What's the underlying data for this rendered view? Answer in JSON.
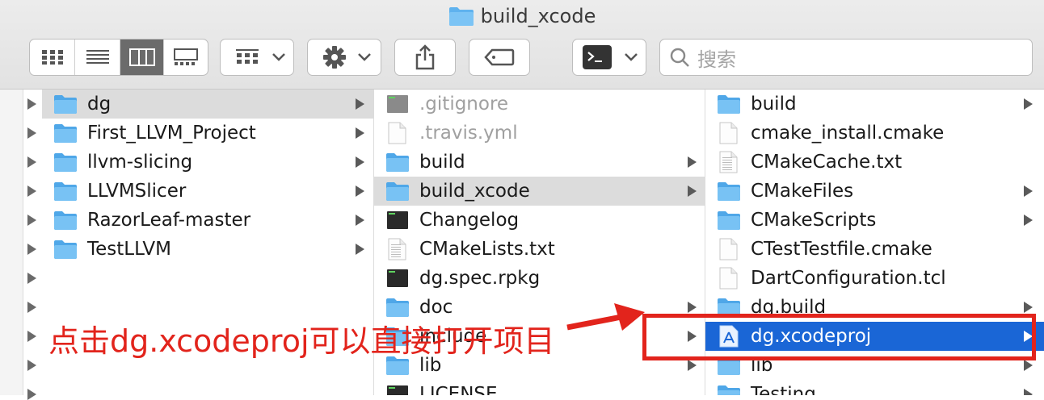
{
  "window": {
    "title": "build_xcode"
  },
  "toolbar": {
    "view_modes": [
      "icon-view",
      "list-view",
      "column-view",
      "gallery-view"
    ],
    "active_view": "column-view",
    "search_placeholder": "搜索"
  },
  "columns": [
    {
      "items": [
        {
          "name": "dg",
          "type": "folder",
          "selected": true,
          "has_children": true
        },
        {
          "name": "First_LLVM_Project",
          "type": "folder",
          "has_children": true
        },
        {
          "name": "llvm-slicing",
          "type": "folder",
          "has_children": true
        },
        {
          "name": "LLVMSlicer",
          "type": "folder",
          "has_children": true
        },
        {
          "name": "RazorLeaf-master",
          "type": "folder",
          "has_children": true
        },
        {
          "name": "TestLLVM",
          "type": "folder",
          "has_children": true
        }
      ]
    },
    {
      "items": [
        {
          "name": ".gitignore",
          "type": "exec",
          "dim": true
        },
        {
          "name": ".travis.yml",
          "type": "doc",
          "dim": true
        },
        {
          "name": "build",
          "type": "folder",
          "has_children": true
        },
        {
          "name": "build_xcode",
          "type": "folder",
          "selected": true,
          "has_children": true
        },
        {
          "name": "Changelog",
          "type": "exec"
        },
        {
          "name": "CMakeLists.txt",
          "type": "text"
        },
        {
          "name": "dg.spec.rpkg",
          "type": "exec"
        },
        {
          "name": "doc",
          "type": "folder",
          "has_children": true
        },
        {
          "name": "include",
          "type": "folder",
          "has_children": true
        },
        {
          "name": "lib",
          "type": "folder",
          "has_children": true
        },
        {
          "name": "LICENSE",
          "type": "exec"
        }
      ]
    },
    {
      "items": [
        {
          "name": "build",
          "type": "folder",
          "has_children": true
        },
        {
          "name": "cmake_install.cmake",
          "type": "doc"
        },
        {
          "name": "CMakeCache.txt",
          "type": "text"
        },
        {
          "name": "CMakeFiles",
          "type": "folder",
          "has_children": true
        },
        {
          "name": "CMakeScripts",
          "type": "folder",
          "has_children": true
        },
        {
          "name": "CTestTestfile.cmake",
          "type": "doc"
        },
        {
          "name": "DartConfiguration.tcl",
          "type": "doc"
        },
        {
          "name": "dg.build",
          "type": "folder",
          "has_children": true
        },
        {
          "name": "dg.xcodeproj",
          "type": "xcodeproj",
          "selected_blue": true,
          "has_children": true
        },
        {
          "name": "lib",
          "type": "folder",
          "has_children": true
        },
        {
          "name": "Testing",
          "type": "folder",
          "has_children": true
        }
      ]
    }
  ],
  "annotation": {
    "text": "点击dg.xcodeproj可以直接打开项目",
    "color": "#e2241c"
  },
  "colors": {
    "folder": "#6ab8ef",
    "selection_blue": "#1a66d6",
    "accent_red": "#e2241c"
  }
}
